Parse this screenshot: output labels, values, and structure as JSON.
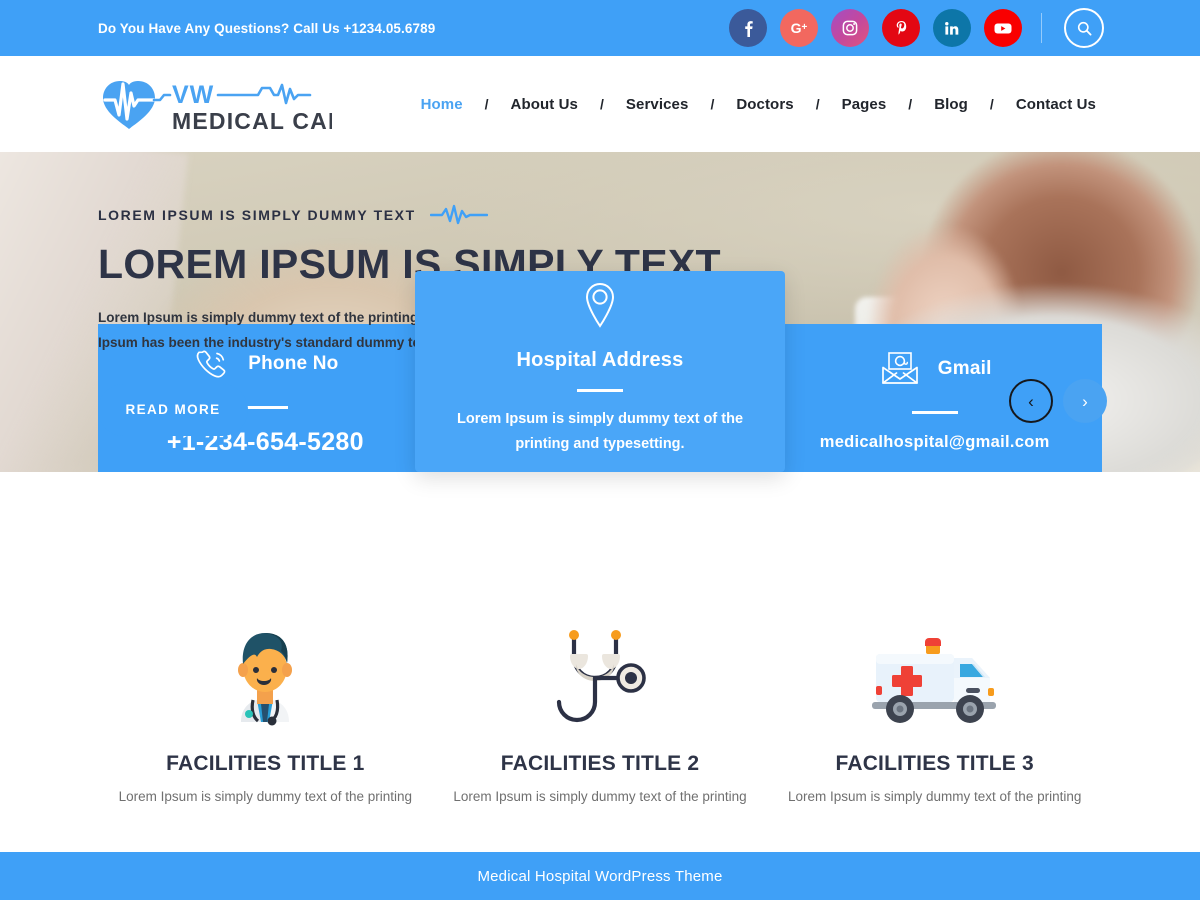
{
  "topbar": {
    "contact_text": "Do You Have Any Questions? Call Us +1234.05.6789",
    "socials": [
      {
        "name": "facebook",
        "glyph": "f"
      },
      {
        "name": "google-plus",
        "glyph": "G+"
      },
      {
        "name": "instagram",
        "glyph": "▢"
      },
      {
        "name": "pinterest",
        "glyph": "P"
      },
      {
        "name": "linkedin",
        "glyph": "in"
      },
      {
        "name": "youtube",
        "glyph": "▶"
      }
    ],
    "search_icon": "search-icon"
  },
  "logo": {
    "brand_initials": "VW",
    "brand_name": "MEDICAL CARE",
    "icon": "heart-pulse-icon"
  },
  "nav": {
    "separator": "/",
    "items": [
      {
        "label": "Home",
        "active": true
      },
      {
        "label": "About Us",
        "active": false
      },
      {
        "label": "Services",
        "active": false
      },
      {
        "label": "Doctors",
        "active": false
      },
      {
        "label": "Pages",
        "active": false
      },
      {
        "label": "Blog",
        "active": false
      },
      {
        "label": "Contact Us",
        "active": false
      }
    ]
  },
  "hero": {
    "subtitle": "LOREM IPSUM IS SIMPLY DUMMY TEXT",
    "pulse_icon": "heartbeat-line-icon",
    "title": "LOREM IPSUM IS SIMPLY TEXT",
    "description": "Lorem Ipsum is simply dummy text of the printing and typesetting industry. Lorem Ipsum has been the industry's standard dummy text ever since the 1500s.",
    "button_label": "READ MORE",
    "prev_arrow": "‹",
    "next_arrow": "›"
  },
  "info_cards": {
    "phone": {
      "icon": "phone-icon",
      "title": "Phone No",
      "value": "+1-234-654-5280"
    },
    "address": {
      "icon": "map-pin-icon",
      "title": "Hospital Address",
      "value": "Lorem Ipsum is simply dummy text of the printing and typesetting."
    },
    "email": {
      "icon": "envelope-at-icon",
      "title": "Gmail",
      "value": "medicalhospital@gmail.com"
    }
  },
  "facilities": [
    {
      "icon": "doctor-avatar-icon",
      "title": "FACILITIES TITLE 1",
      "text": "Lorem Ipsum is simply dummy text of the printing"
    },
    {
      "icon": "stethoscope-icon",
      "title": "FACILITIES TITLE 2",
      "text": "Lorem Ipsum is simply dummy text of the printing"
    },
    {
      "icon": "ambulance-icon",
      "title": "FACILITIES TITLE 3",
      "text": "Lorem Ipsum is simply dummy text of the printing"
    }
  ],
  "footer": {
    "text": "Medical Hospital WordPress Theme"
  },
  "colors": {
    "primary_blue": "#3fa0f7",
    "light_blue": "#4aa6f8",
    "dark_navy": "#2e3447",
    "body_gray": "#707070"
  }
}
